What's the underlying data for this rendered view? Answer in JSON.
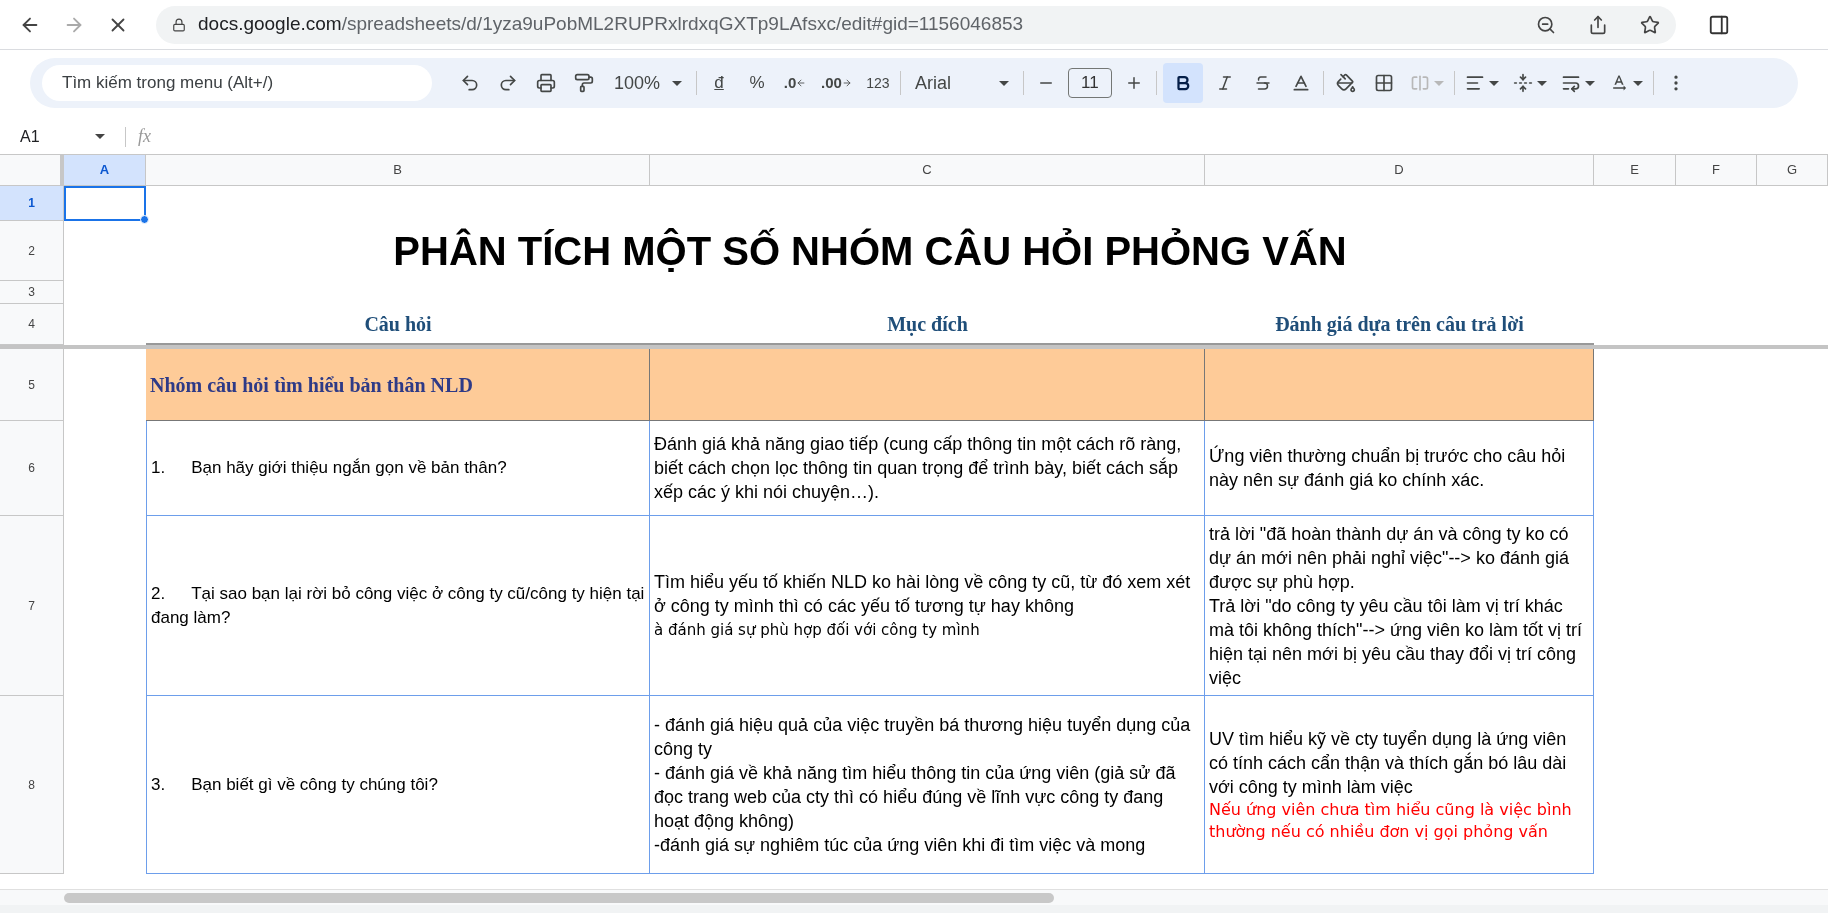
{
  "browser": {
    "url_host": "docs.google.com",
    "url_path": "/spreadsheets/d/1yza9uPobML2RUPRxlrdxqGXTp9LAfsxc/edit#gid=1156046853",
    "loading": true
  },
  "toolbar": {
    "menu_search": "Tìm kiếm trong menu (Alt+/)",
    "zoom": "100%",
    "currency": "đ",
    "percent": "%",
    "decrease_decimal": ".0",
    "increase_decimal": ".00",
    "number_format": "123",
    "font": "Arial",
    "font_size": "11",
    "bold": true,
    "merge_disabled": true
  },
  "formula_bar": {
    "name_box": "A1",
    "fx": "fx"
  },
  "columns": [
    {
      "label": "A",
      "selected": true
    },
    {
      "label": "B",
      "selected": false
    },
    {
      "label": "C",
      "selected": false
    },
    {
      "label": "D",
      "selected": false
    },
    {
      "label": "E",
      "selected": false
    },
    {
      "label": "F",
      "selected": false
    },
    {
      "label": "G",
      "selected": false
    }
  ],
  "rows": [
    {
      "label": "1",
      "selected": true
    },
    {
      "label": "2",
      "selected": false
    },
    {
      "label": "3",
      "selected": false
    },
    {
      "label": "4",
      "selected": false
    },
    {
      "label": "5",
      "selected": false
    },
    {
      "label": "6",
      "selected": false
    },
    {
      "label": "7",
      "selected": false
    },
    {
      "label": "8",
      "selected": false
    }
  ],
  "sheet": {
    "title": "PHÂN TÍCH MỘT SỐ NHÓM CÂU HỎI PHỎNG VẤN",
    "headers": [
      "Câu hỏi",
      "Mục đích",
      "Đánh giá dựa trên câu trả lời"
    ],
    "section": "Nhóm câu hỏi tìm hiểu bản thân NLD",
    "questions": [
      {
        "number": "1.",
        "question": "Bạn hãy giới thiệu ngắn gọn về bản thân?",
        "purpose": [
          {
            "kind": "plain",
            "text": "Đánh giá khả năng giao tiếp (cung cấp thông tin một cách rõ ràng, biết cách chọn lọc thông tin quan trọng để trình bày, biết cách sắp xếp các ý khi nói chuyện…)."
          }
        ],
        "evaluation": [
          {
            "kind": "plain",
            "text": "Ứng viên thường chuẩn bị trước cho câu hỏi này nên sự đánh giá ko chính xác."
          }
        ]
      },
      {
        "number": "2.",
        "question": "Tại sao bạn lại rời bỏ công việc ở công ty cũ/công ty hiện tại đang làm?",
        "purpose": [
          {
            "kind": "plain",
            "text": "Tìm hiểu yếu tố khiến NLD ko hài lòng về công ty cũ, từ đó xem xét ở công ty mình thì có các yếu tố tương tự hay không"
          },
          {
            "kind": "note",
            "text": "à đánh giá sự phù hợp đối với công ty mình"
          }
        ],
        "evaluation": [
          {
            "kind": "plain",
            "text": "trả lời \"đã hoàn thành dự án và công ty ko có dự án mới nên phải nghỉ việc\"-->  ko đánh giá được sự phù hợp."
          },
          {
            "kind": "plain",
            "text": "Trả lời \"do công ty yêu cầu tôi làm vị trí khác mà tôi không thích\"--> ứng viên ko làm tốt vị trí hiện tại nên mới bị yêu cầu thay đổi vị trí công việc"
          }
        ]
      },
      {
        "number": "3.",
        "question": "Bạn biết gì về công ty chúng tôi?",
        "purpose": [
          {
            "kind": "plain",
            "text": "- đánh giá hiệu quả của việc truyền bá thương hiệu tuyển dụng của công ty"
          },
          {
            "kind": "plain",
            "text": "- đánh giá về khả năng tìm hiểu thông tin của ứng viên (giả sử đã đọc trang web của cty thì có hiểu đúng về lĩnh vực công ty đang hoạt động không)"
          },
          {
            "kind": "plain",
            "text": "-đánh giá sự nghiêm túc của ứng viên khi đi tìm việc và mong"
          }
        ],
        "evaluation": [
          {
            "kind": "plain",
            "text": "UV tìm hiểu kỹ về cty tuyển dụng là ứng viên có tính cách cẩn thận và thích gắn bó lâu dài với công ty mình làm việc"
          },
          {
            "kind": "warning",
            "text": "Nếu ứng viên chưa tìm hiểu cũng là việc bình thường nếu có nhiều đơn vị gọi phỏng vấn"
          }
        ]
      }
    ]
  }
}
